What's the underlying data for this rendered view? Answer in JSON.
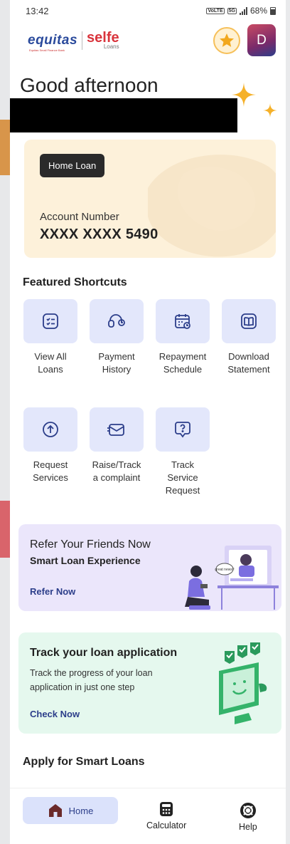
{
  "status_bar": {
    "time": "13:42",
    "network_label": "VoLTE",
    "signal_label": "5G",
    "battery": "68%"
  },
  "header": {
    "brand_primary": "equitas",
    "brand_primary_tagline": "Equitas Small Finance Bank",
    "brand_secondary": "selfe",
    "brand_secondary_sub": "Loans",
    "rewards_icon": "star-icon",
    "avatar_initial": "D"
  },
  "greeting": "Good afternoon",
  "loan_card": {
    "badge": "Home Loan",
    "account_label": "Account Number",
    "account_number": "XXXX XXXX 5490"
  },
  "shortcuts": {
    "title": "Featured Shortcuts",
    "items": [
      {
        "line1": "View All",
        "line2": "Loans",
        "line3": "",
        "icon": "list-icon"
      },
      {
        "line1": "Payment",
        "line2": "History",
        "line3": "",
        "icon": "payment-history-icon"
      },
      {
        "line1": "Repayment",
        "line2": "Schedule",
        "line3": "",
        "icon": "calendar-icon"
      },
      {
        "line1": "Download",
        "line2": "Statement",
        "line3": "",
        "icon": "book-icon"
      },
      {
        "line1": "Request",
        "line2": "Services",
        "line3": "",
        "icon": "upload-circle-icon"
      },
      {
        "line1": "Raise/Track",
        "line2": "a complaint",
        "line3": "",
        "icon": "mail-icon"
      },
      {
        "line1": "Track",
        "line2": "Service",
        "line3": "Request",
        "icon": "question-chat-icon"
      }
    ]
  },
  "refer": {
    "title": "Refer Your Friends Now",
    "subtitle": "Smart Loan Experience",
    "cta": "Refer Now",
    "bubble_text": "great news!!"
  },
  "track_app": {
    "title": "Track your loan application",
    "description": "Track the progress of your loan application in just one step",
    "cta": "Check Now"
  },
  "apply_title": "Apply for Smart Loans",
  "bottom_nav": {
    "home": "Home",
    "calculator": "Calculator",
    "help": "Help"
  },
  "colors": {
    "accent_blue": "#2c3e8a",
    "loan_card_bg": "#fdf1da",
    "shortcut_bg": "#e3e7fb",
    "refer_bg": "#ebe6fb",
    "track_bg": "#e5f8ee",
    "brand_red": "#d9343c"
  }
}
